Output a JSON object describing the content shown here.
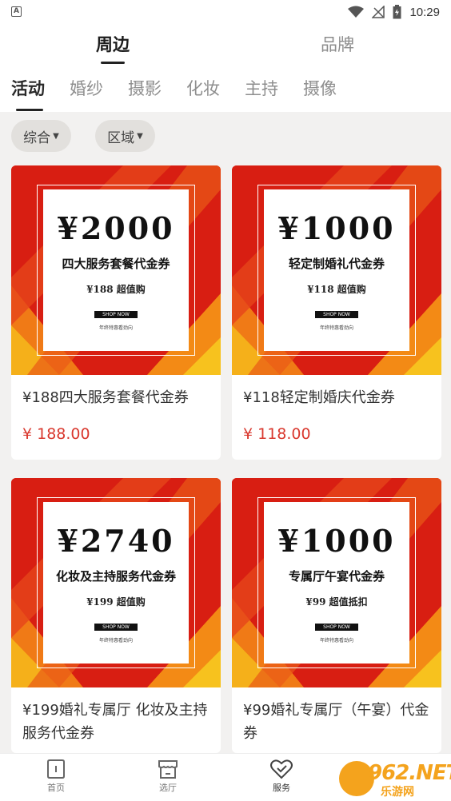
{
  "status": {
    "time": "10:29",
    "sim_letter": "A"
  },
  "top_tabs": [
    {
      "label": "周边",
      "active": true
    },
    {
      "label": "品牌",
      "active": false
    }
  ],
  "categories": [
    {
      "label": "活动",
      "active": true
    },
    {
      "label": "婚纱"
    },
    {
      "label": "摄影"
    },
    {
      "label": "化妆"
    },
    {
      "label": "主持"
    },
    {
      "label": "摄像"
    }
  ],
  "filters": [
    {
      "label": "综合"
    },
    {
      "label": "区域"
    }
  ],
  "products": [
    {
      "coupon_amount": "¥2000",
      "coupon_desc": "四大服务套餐代金券",
      "coupon_price": "¥188 超值购",
      "coupon_shop": "SHOP NOW",
      "coupon_small": "年终特惠看劲向",
      "title": "¥188四大服务套餐代金券",
      "price": "¥ 188.00"
    },
    {
      "coupon_amount": "¥1000",
      "coupon_desc": "轻定制婚礼代金券",
      "coupon_price": "¥118 超值购",
      "coupon_shop": "SHOP NOW",
      "coupon_small": "年终特惠看劲向",
      "title": "¥118轻定制婚庆代金券",
      "price": "¥ 118.00"
    },
    {
      "coupon_amount": "¥2740",
      "coupon_desc": "化妆及主持服务代金券",
      "coupon_price": "¥199 超值购",
      "coupon_shop": "SHOP NOW",
      "coupon_small": "年终特惠看劲向",
      "title": "¥199婚礼专属厅 化妆及主持服务代金券",
      "price": ""
    },
    {
      "coupon_amount": "¥1000",
      "coupon_desc": "专属厅午宴代金券",
      "coupon_price": "¥99 超值抵扣",
      "coupon_shop": "SHOP NOW",
      "coupon_small": "年终特惠看劲向",
      "title": "¥99婚礼专属厅（午宴）代金券",
      "price": ""
    }
  ],
  "bottom_nav": [
    {
      "label": "首页",
      "icon": "home-icon"
    },
    {
      "label": "选厅",
      "icon": "shop-icon"
    },
    {
      "label": "服务",
      "icon": "heart-check-icon",
      "active": true
    }
  ],
  "watermark": {
    "brand": "962.NET",
    "sub": "乐游网"
  },
  "colors": {
    "price": "#d9382e",
    "banner_red": "#d81e12",
    "banner_orange": "#f59a14",
    "watermark": "#f4a31d"
  }
}
